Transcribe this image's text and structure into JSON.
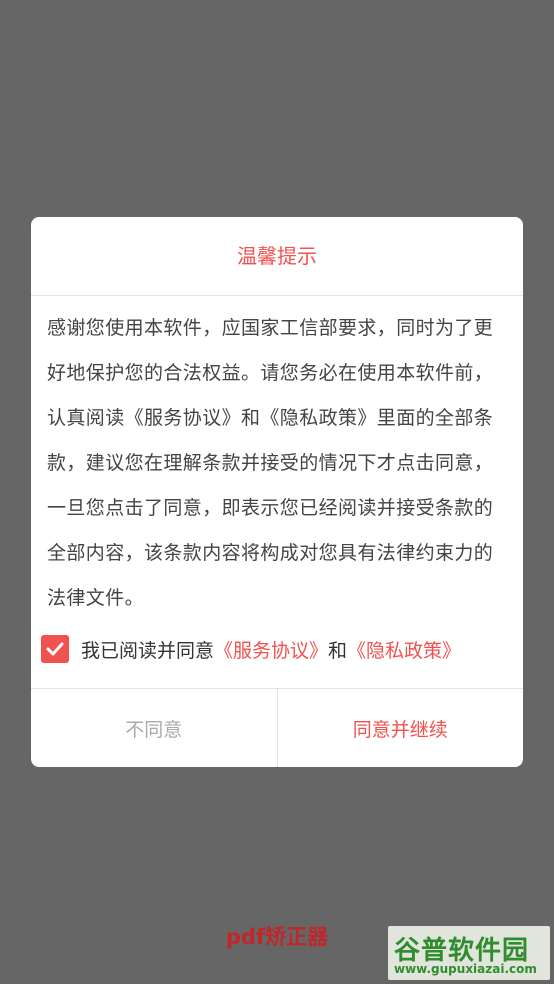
{
  "dialog": {
    "title": "温馨提示",
    "body": "感谢您使用本软件，应国家工信部要求，同时为了更好地保护您的合法权益。请您务必在使用本软件前，认真阅读《服务协议》和《隐私政策》里面的全部条款，建议您在理解条款并接受的情况下才点击同意，一旦您点击了同意，即表示您已经阅读并接受条款的全部内容，该条款内容将构成对您具有法律约束力的法律文件。",
    "agreement": {
      "checked": true,
      "prefix": "我已阅读并同意",
      "service_link": "《服务协议》",
      "connector": "和",
      "privacy_link": "《隐私政策》"
    },
    "buttons": {
      "disagree": "不同意",
      "agree": "同意并继续"
    }
  },
  "app_name": "pdf矫正器",
  "watermark": {
    "logo": "谷普软件园",
    "url": "www.gupuxiazai.com"
  },
  "colors": {
    "accent": "#f0524f",
    "overlay": "#666666"
  }
}
